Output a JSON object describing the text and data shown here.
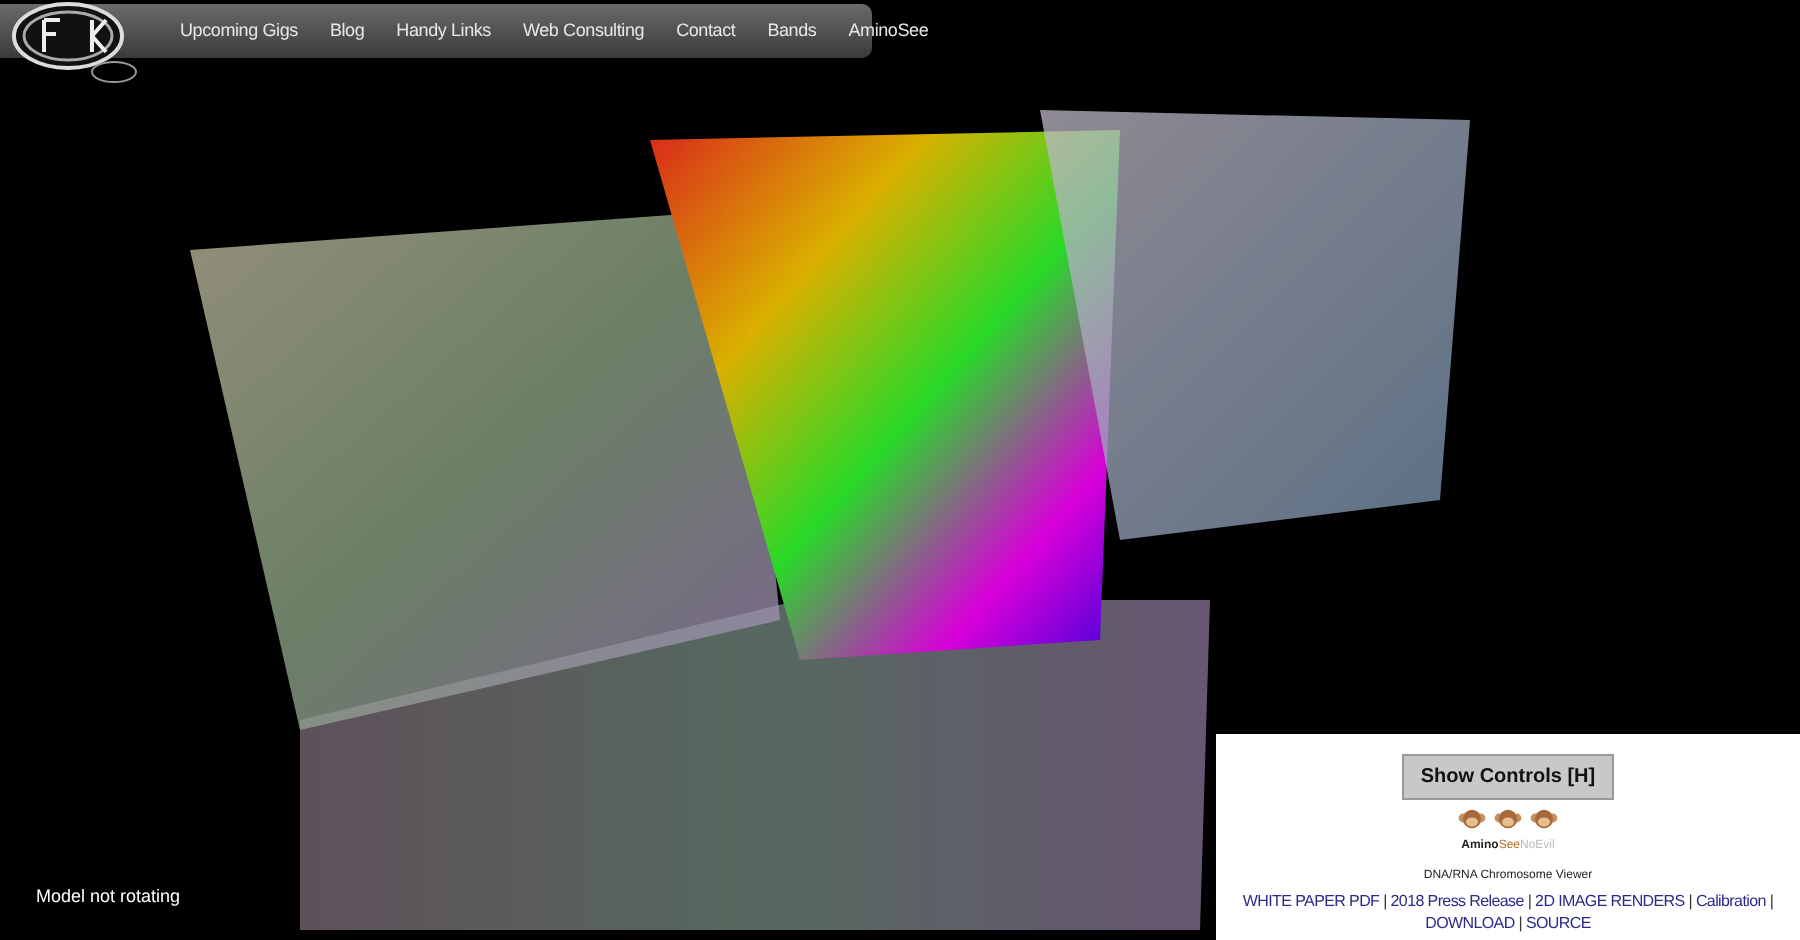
{
  "nav": {
    "items": [
      {
        "label": "Upcoming Gigs"
      },
      {
        "label": "Blog"
      },
      {
        "label": "Handy Links"
      },
      {
        "label": "Web Consulting"
      },
      {
        "label": "Contact"
      },
      {
        "label": "Bands"
      },
      {
        "label": "AminoSee"
      }
    ]
  },
  "status": "Model not rotating",
  "panel": {
    "button": "Show Controls [H]",
    "brand": [
      {
        "text": "Amino",
        "kind": "dark"
      },
      {
        "text": "See",
        "kind": "accent"
      },
      {
        "text": "NoEvil",
        "kind": "faint"
      }
    ],
    "subtitle": "DNA/RNA Chromosome Viewer",
    "separator": "|",
    "links": [
      {
        "label": "WHITE PAPER PDF"
      },
      {
        "label": "2018 Press Release"
      },
      {
        "label": "2D IMAGE RENDERS"
      },
      {
        "label": "Calibration"
      },
      {
        "label": "DOWNLOAD"
      },
      {
        "label": "SOURCE"
      }
    ]
  }
}
